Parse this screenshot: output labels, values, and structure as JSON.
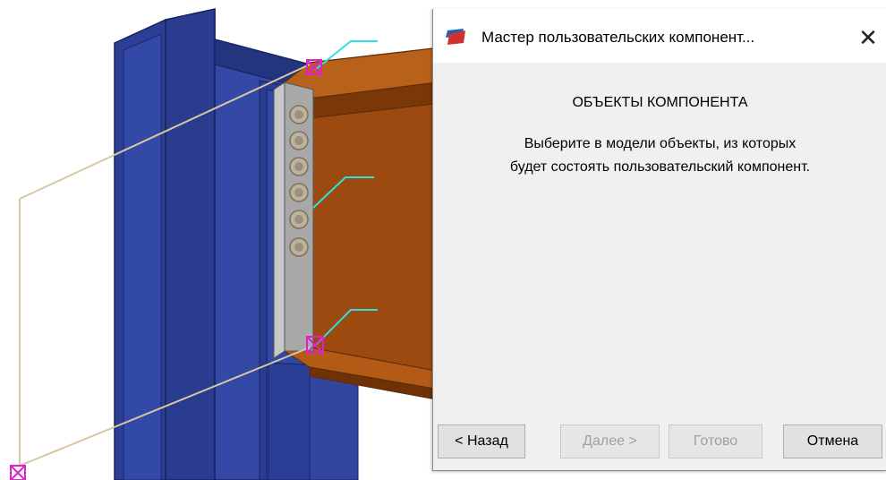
{
  "dialog": {
    "title": "Мастер пользовательских компонент...",
    "close_glyph": "✕",
    "heading": "ОБЪЕКТЫ КОМПОНЕНТА",
    "description_line1": "Выберите в модели объекты, из которых",
    "description_line2": "будет состоять пользовательский компонент.",
    "buttons": {
      "back": "< Назад",
      "next": "Далее >",
      "finish": "Готово",
      "cancel": "Отмена"
    }
  },
  "colors": {
    "column_blue": "#2a3f9a",
    "beam_orange": "#9c4a10",
    "end_plate_gray": "#9a9a9a",
    "bolt": "#b8b09a",
    "selection_magenta": "#e020c8",
    "leader_cyan": "#30e0e0",
    "guide_tan": "#d8c8a0"
  },
  "icons": [
    "app-icon",
    "close-icon",
    "bolt-icon",
    "handle-icon"
  ]
}
